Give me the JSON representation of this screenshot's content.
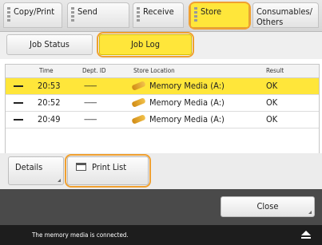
{
  "tabs": [
    {
      "label": "Copy/Print"
    },
    {
      "label": "Send"
    },
    {
      "label": "Receive"
    },
    {
      "label": "Store"
    },
    {
      "label_line1": "Consumables/",
      "label_line2": "Others"
    }
  ],
  "subtabs": [
    "Job Status",
    "Job Log"
  ],
  "table": {
    "headers": [
      "Time",
      "Dept. ID",
      "Store Location",
      "Result"
    ],
    "rows": [
      {
        "time": "20:53",
        "dept": "--------",
        "location": "Memory Media (A:)",
        "result": "OK"
      },
      {
        "time": "20:52",
        "dept": "--------",
        "location": "Memory Media (A:)",
        "result": "OK"
      },
      {
        "time": "20:49",
        "dept": "--------",
        "location": "Memory Media (A:)",
        "result": "OK"
      }
    ]
  },
  "buttons": {
    "details": "Details",
    "print_list": "Print List",
    "close": "Close"
  },
  "status": {
    "message": "The memory media is connected."
  },
  "colors": {
    "accent": "#ffe63a",
    "highlight_ring": "#f0a030"
  }
}
